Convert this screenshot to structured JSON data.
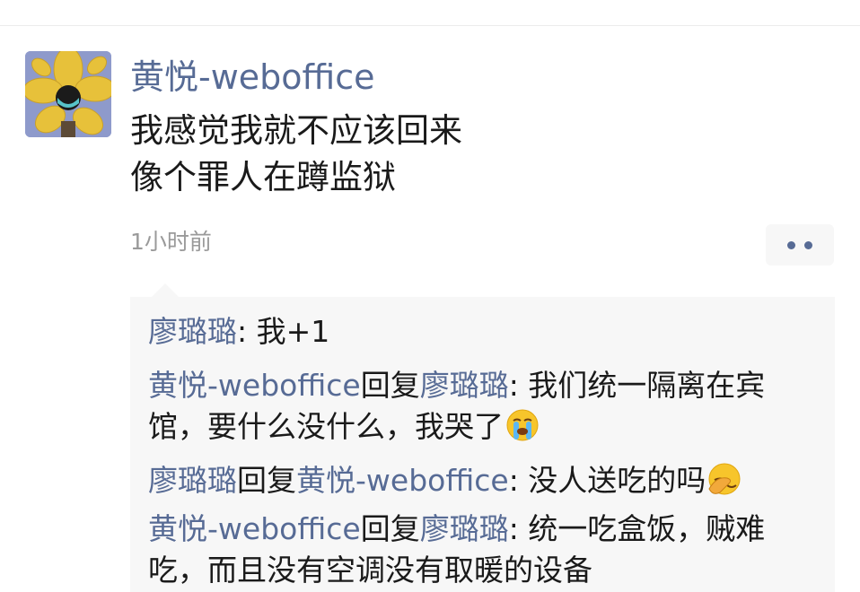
{
  "post": {
    "author": "黄悦-weboffice",
    "content_lines": [
      "我感觉我就不应该回来",
      "像个罪人在蹲监狱"
    ],
    "time": "1小时前"
  },
  "comments": [
    {
      "user": "廖璐璐",
      "text": ": 我+1"
    },
    {
      "user": "黄悦-weboffice",
      "reply_word": "回复",
      "reply_to": "廖璐璐",
      "text_line1": ": 我们统一隔离在宾",
      "text_line2": "馆，要什么没什么，我哭了",
      "emoji": "crying-face-emoji"
    },
    {
      "user": "廖璐璐",
      "reply_word": "回复",
      "reply_to": "黄悦-weboffice",
      "text": ": 没人送吃的吗",
      "emoji": "face-palm-emoji"
    },
    {
      "user": "黄悦-weboffice",
      "reply_word": "回复",
      "reply_to": "廖璐璐",
      "text_line1": ": 统一吃盒饭，贼难",
      "text_line2": "吃，而且没有空调没有取暖的设备"
    }
  ],
  "colors": {
    "name_link": "#576b95",
    "text": "#1a1a1a",
    "time": "#9a9a9a",
    "comment_bg": "#f7f7f7"
  }
}
